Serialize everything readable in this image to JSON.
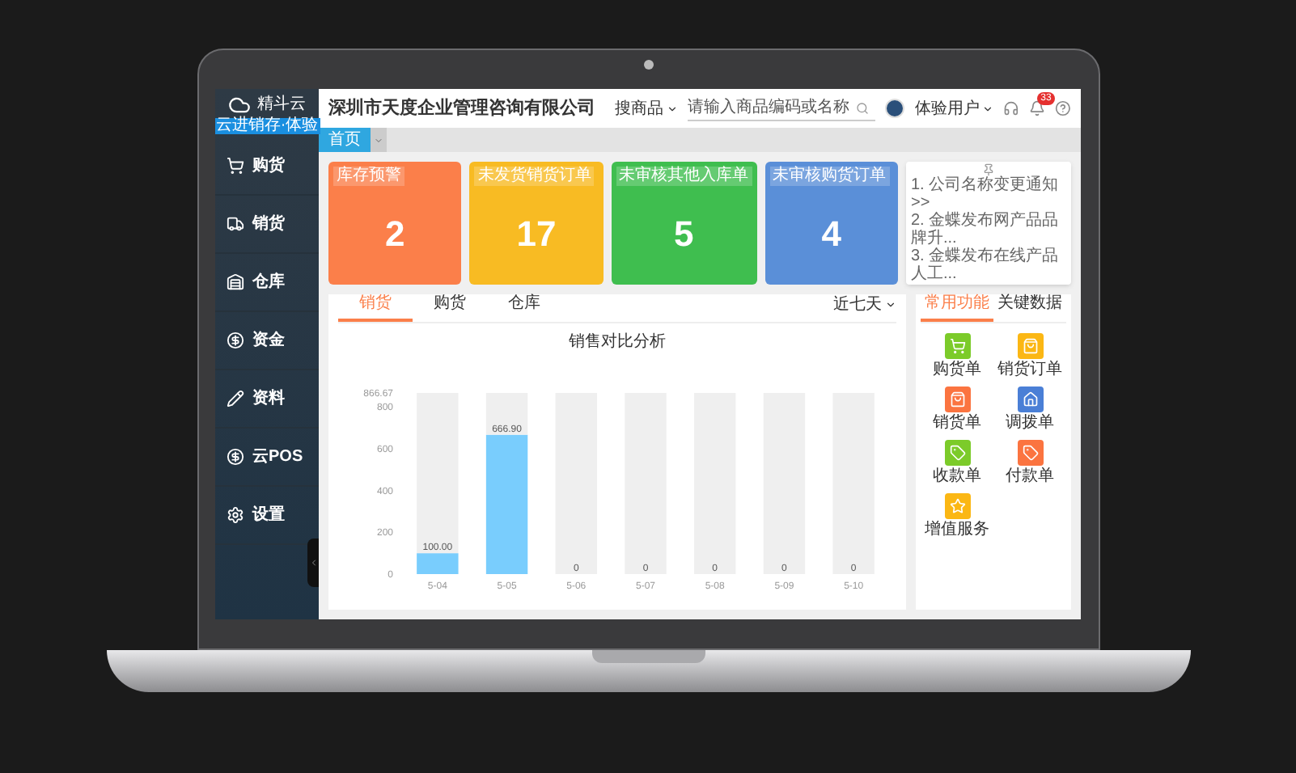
{
  "sidebar": {
    "logo_text": "精斗云",
    "logo_subtitle": "云进销存·体验",
    "items": [
      {
        "label": "购货"
      },
      {
        "label": "销货"
      },
      {
        "label": "仓库"
      },
      {
        "label": "资金"
      },
      {
        "label": "资料"
      },
      {
        "label": "云POS"
      },
      {
        "label": "设置"
      }
    ]
  },
  "header": {
    "company": "深圳市天度企业管理咨询有限公司",
    "search_scope": "搜商品",
    "search": {
      "placeholder": "请输入商品编码或名称"
    },
    "user": "体验用户",
    "notification_count": "33"
  },
  "tabs": [
    {
      "label": "首页",
      "selected": true
    }
  ],
  "cards": [
    {
      "title": "库存预警",
      "value": "2",
      "color": "#fb7f4a"
    },
    {
      "title": "未发货销货订单",
      "value": "17",
      "color": "#f8bb23"
    },
    {
      "title": "未审核其他入库单",
      "value": "5",
      "color": "#3fbe4f"
    },
    {
      "title": "未审核购货订单",
      "value": "4",
      "color": "#5a8fd8"
    }
  ],
  "notices": [
    "1. 公司名称变更通知>>",
    "2. 金蝶发布网产品品牌升...",
    "3. 金蝶发布在线产品人工..."
  ],
  "chart_panel": {
    "tabs": [
      {
        "label": "销货",
        "selected": true
      },
      {
        "label": "购货",
        "selected": false
      },
      {
        "label": "仓库",
        "selected": false
      }
    ],
    "period": "近七天",
    "chart_data": {
      "type": "bar",
      "title": "销售对比分析",
      "categories": [
        "5-04",
        "5-05",
        "5-06",
        "5-07",
        "5-08",
        "5-09",
        "5-10"
      ],
      "stacked": true,
      "series": [
        {
          "color": "#79cdfd",
          "values": [
            100,
            666.9,
            0,
            0,
            0,
            0,
            0
          ]
        },
        {
          "color": "#efefef",
          "values": [
            766.67,
            199.77,
            866.67,
            866.67,
            866.67,
            866.67,
            866.67
          ]
        }
      ],
      "ylim": [
        0,
        866.67
      ],
      "yticks": [
        0,
        200,
        400,
        600,
        800,
        {
          "value": 866.67,
          "label": "866.67"
        }
      ],
      "value_labels": [
        "100.00",
        "666.90",
        "0",
        "0",
        "0",
        "0",
        "0"
      ]
    }
  },
  "shortcuts": {
    "tabs": [
      {
        "label": "常用功能",
        "selected": true
      },
      {
        "label": "关键数据",
        "selected": false
      }
    ],
    "items": [
      {
        "label": "购货单",
        "color": "#7ccb2a"
      },
      {
        "label": "销货订单",
        "color": "#fbb714"
      },
      {
        "label": "销货单",
        "color": "#fb7440"
      },
      {
        "label": "调拨单",
        "color": "#4a7fd6"
      },
      {
        "label": "收款单",
        "color": "#7ccb2a"
      },
      {
        "label": "付款单",
        "color": "#fb7440"
      },
      {
        "label": "增值服务",
        "color": "#fbb714"
      }
    ]
  }
}
